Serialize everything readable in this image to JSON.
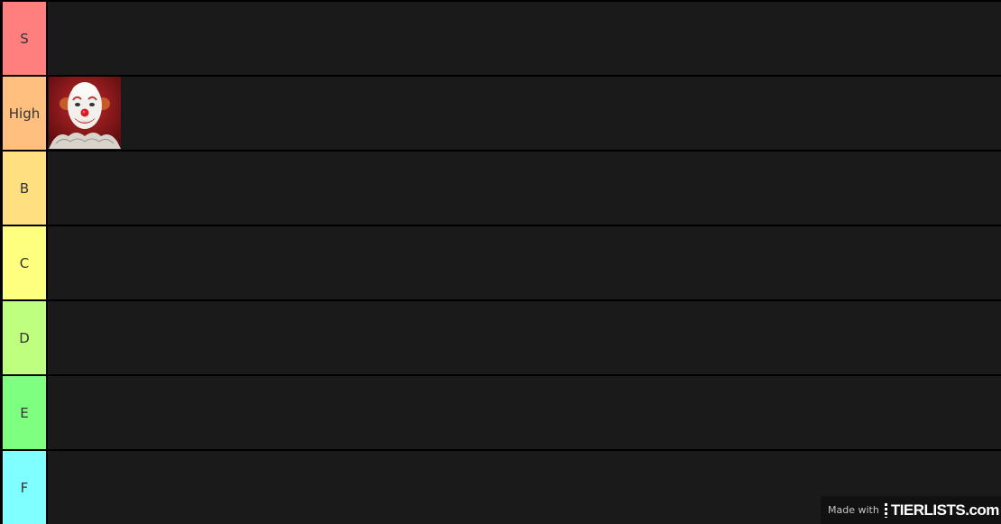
{
  "tiers": [
    {
      "label": "S",
      "color": "#ff7f7f"
    },
    {
      "label": "High",
      "color": "#ffbf7f"
    },
    {
      "label": "B",
      "color": "#ffdf7f"
    },
    {
      "label": "C",
      "color": "#ffff7f"
    },
    {
      "label": "D",
      "color": "#bfff7f"
    },
    {
      "label": "E",
      "color": "#7fff7f"
    },
    {
      "label": "F",
      "color": "#7fffff"
    }
  ],
  "items": [
    {
      "tier": "High",
      "image": "clown-portrait"
    }
  ],
  "watermark": {
    "prefix": "Made with",
    "logo": "TIERLISTS.com"
  },
  "colors": {
    "row_background": "#1a1a1a",
    "page_background": "#000000"
  }
}
